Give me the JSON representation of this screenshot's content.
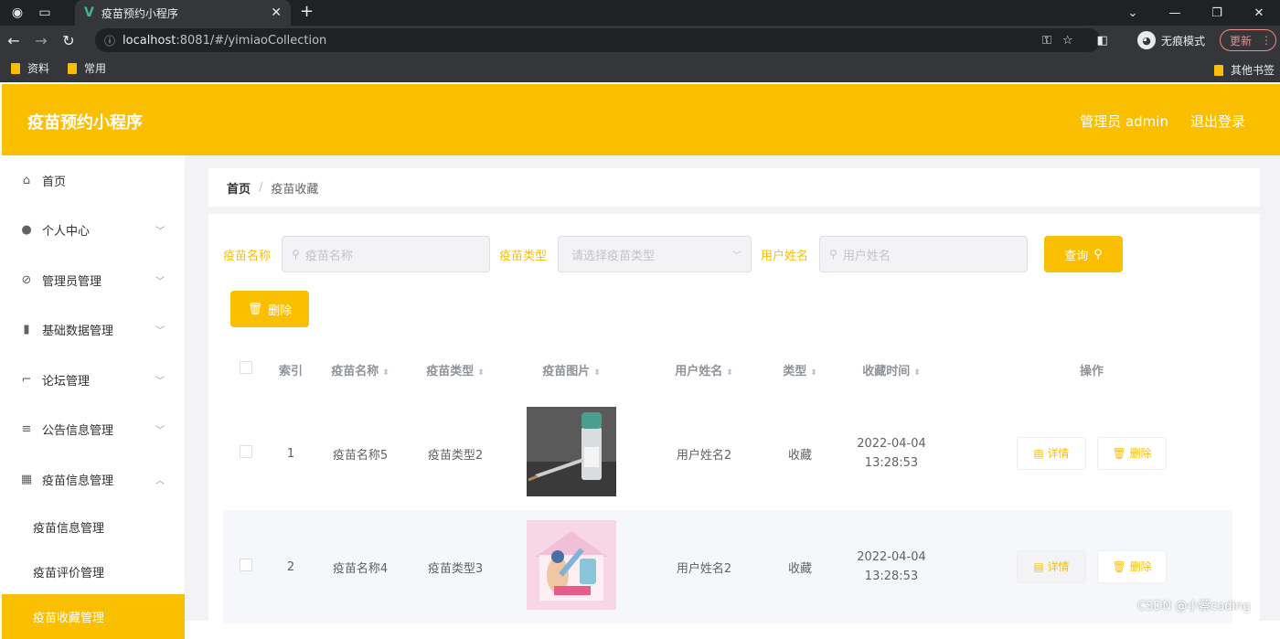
{
  "browser": {
    "tab_title": "疫苗预约小程序",
    "url_host": "localhost",
    "url_rest": ":8081/#/yimiaoCollection",
    "incognito_label": "无痕模式",
    "update_label": "更新",
    "bookmarks": [
      "资料",
      "常用"
    ],
    "bookmarks_other": "其他书签"
  },
  "header": {
    "title": "疫苗预约小程序",
    "user_label": "管理员 admin",
    "logout_label": "退出登录"
  },
  "sidebar": {
    "items": [
      {
        "label": "首页",
        "icon": "home-icon"
      },
      {
        "label": "个人中心",
        "icon": "user-icon"
      },
      {
        "label": "管理员管理",
        "icon": "admin-icon"
      },
      {
        "label": "基础数据管理",
        "icon": "chart-icon"
      },
      {
        "label": "论坛管理",
        "icon": "forum-icon"
      },
      {
        "label": "公告信息管理",
        "icon": "list-icon"
      },
      {
        "label": "疫苗信息管理",
        "icon": "grid-icon"
      }
    ],
    "sub_items": [
      "疫苗信息管理",
      "疫苗评价管理",
      "疫苗收藏管理"
    ]
  },
  "breadcrumb": {
    "home": "首页",
    "separator": "/",
    "current": "疫苗收藏"
  },
  "search": {
    "name_label": "疫苗名称",
    "name_placeholder": "疫苗名称",
    "type_label": "疫苗类型",
    "type_placeholder": "请选择疫苗类型",
    "user_label": "用户姓名",
    "user_placeholder": "用户姓名",
    "query_label": "查询"
  },
  "toolbar": {
    "delete_label": "删除"
  },
  "table": {
    "columns": [
      "索引",
      "疫苗名称",
      "疫苗类型",
      "疫苗图片",
      "用户姓名",
      "类型",
      "收藏时间",
      "操作"
    ],
    "rows": [
      {
        "index": "1",
        "name": "疫苗名称5",
        "type": "疫苗类型2",
        "user": "用户姓名2",
        "kind": "收藏",
        "date": "2022-04-04",
        "time": "13:28:53"
      },
      {
        "index": "2",
        "name": "疫苗名称4",
        "type": "疫苗类型3",
        "user": "用户姓名2",
        "kind": "收藏",
        "date": "2022-04-04",
        "time": "13:28:53"
      }
    ],
    "detail_label": "详情",
    "delete_label": "删除"
  },
  "watermark": "CSDN @小蔡coding",
  "colors": {
    "accent": "#fbbf02"
  }
}
